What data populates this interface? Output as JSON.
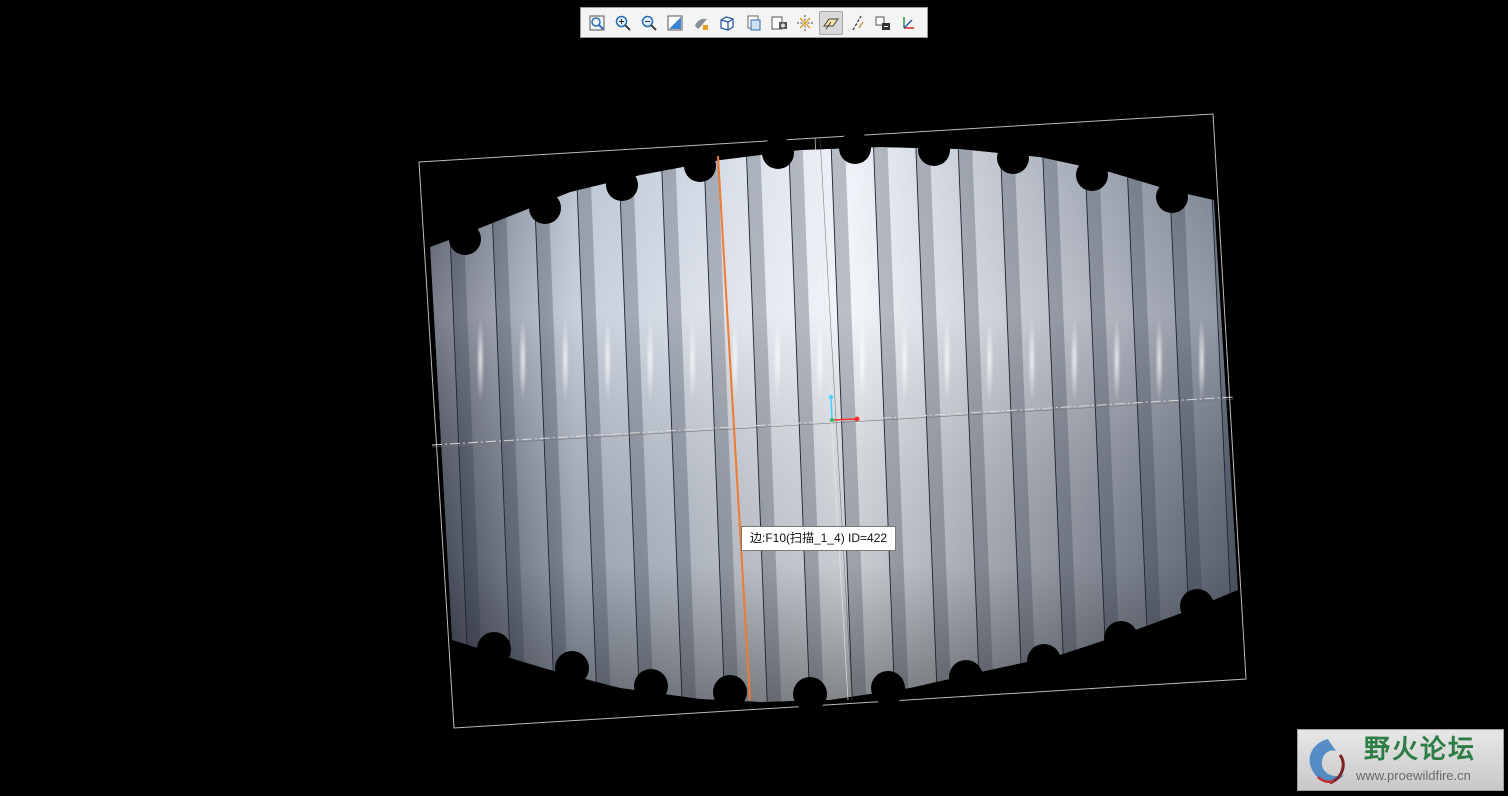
{
  "toolbar": {
    "buttons": [
      {
        "name": "refit-icon",
        "active": false
      },
      {
        "name": "zoom-in-icon",
        "active": false
      },
      {
        "name": "zoom-out-icon",
        "active": false
      },
      {
        "name": "repaint-icon",
        "active": false
      },
      {
        "name": "display-style-icon",
        "active": false
      },
      {
        "name": "saved-orientations-icon",
        "active": false
      },
      {
        "name": "view-manager-icon",
        "active": false
      },
      {
        "name": "perspective-icon",
        "active": false
      },
      {
        "name": "spin-center-icon",
        "active": false
      },
      {
        "name": "datum-planes-icon",
        "active": true
      },
      {
        "name": "datum-axes-icon",
        "active": false
      },
      {
        "name": "datum-points-icon",
        "active": false
      },
      {
        "name": "coordinate-systems-icon",
        "active": false
      }
    ]
  },
  "tooltip": {
    "text": "边:F10(扫描_1_4) ID=422"
  },
  "model": {
    "surface_color": "#a9b3c2",
    "highlight_color": "#f07a30",
    "csys_x_color": "#ff3030",
    "csys_y_color": "#30c060",
    "csys_z_color": "#40d0ff"
  },
  "watermark": {
    "title": "野火论坛",
    "url": "www.proewildfire.cn"
  }
}
